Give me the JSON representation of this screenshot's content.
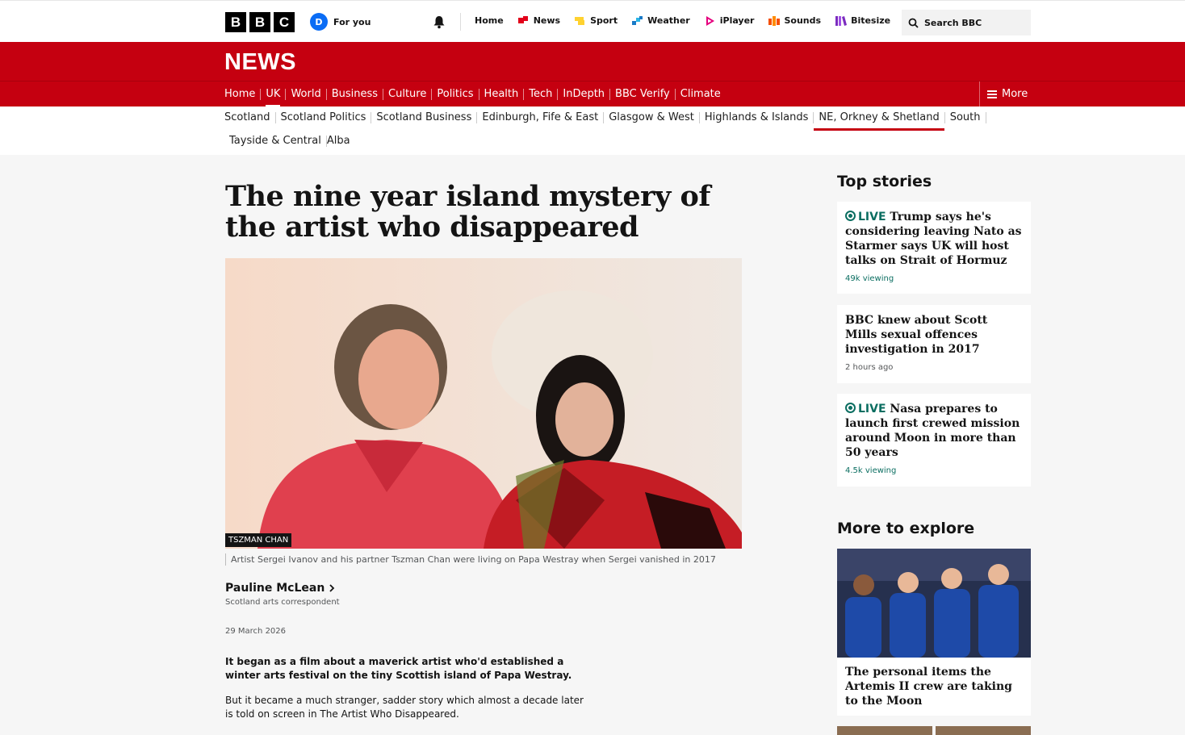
{
  "header": {
    "logo_letters": [
      "B",
      "B",
      "C"
    ],
    "avatar_letter": "D",
    "for_you": "For you",
    "nav": [
      {
        "label": "Home",
        "icon": "none"
      },
      {
        "label": "News",
        "icon": "news-icon",
        "color": "#e2001a"
      },
      {
        "label": "Sport",
        "icon": "sport-icon",
        "color": "#ffd230"
      },
      {
        "label": "Weather",
        "icon": "weather-icon",
        "color": "#1a7ac7"
      },
      {
        "label": "iPlayer",
        "icon": "iplayer-icon",
        "color": "#e5007d"
      },
      {
        "label": "Sounds",
        "icon": "sounds-icon",
        "color": "#f54e00"
      },
      {
        "label": "Bitesize",
        "icon": "bitesize-icon",
        "color": "#7b2cbf"
      }
    ],
    "search_placeholder": "Search BBC"
  },
  "news_banner": {
    "logo": "NEWS",
    "color": "#c50010"
  },
  "section_nav": {
    "items": [
      "Home",
      "UK",
      "World",
      "Business",
      "Culture",
      "Politics",
      "Health",
      "Tech",
      "InDepth",
      "BBC Verify",
      "Climate"
    ],
    "active": "UK",
    "more_label": "More"
  },
  "sub_nav": {
    "items": [
      "Scotland",
      "Scotland Politics",
      "Scotland Business",
      "Edinburgh, Fife & East",
      "Glasgow & West",
      "Highlands & Islands",
      "NE, Orkney & Shetland",
      "South",
      "Tayside & Central",
      "Alba"
    ],
    "active": "NE, Orkney & Shetland"
  },
  "article": {
    "headline": "The nine year island mystery of the artist who disappeared",
    "image_credit": "TSZMAN CHAN",
    "caption": "Artist Sergei Ivanov and his partner Tszman Chan were living on Papa Westray when Sergei vanished in 2017",
    "author": "Pauline McLean",
    "author_role": "Scotland arts correspondent",
    "date": "29 March 2026",
    "lede": "It began as a film about a maverick artist who'd established a winter arts festival on the tiny Scottish island of Papa Westray.",
    "paragraph": "But it became a much stranger, sadder story which almost a decade later is told on screen in The Artist Who Disappeared."
  },
  "sidebar": {
    "top_stories_heading": "Top stories",
    "stories": [
      {
        "live": true,
        "live_label": "LIVE",
        "title": "Trump says he's considering leaving Nato as Starmer says UK will host talks on Strait of Hormuz",
        "meta": "49k viewing"
      },
      {
        "live": false,
        "title": "BBC knew about Scott Mills sexual offences investigation in 2017",
        "meta": "2 hours ago"
      },
      {
        "live": true,
        "live_label": "LIVE",
        "title": "Nasa prepares to launch first crewed mission around Moon in more than 50 years",
        "meta": "4.5k viewing"
      }
    ],
    "explore_heading": "More to explore",
    "explore_title": "The personal items the Artemis II crew are taking to the Moon"
  }
}
